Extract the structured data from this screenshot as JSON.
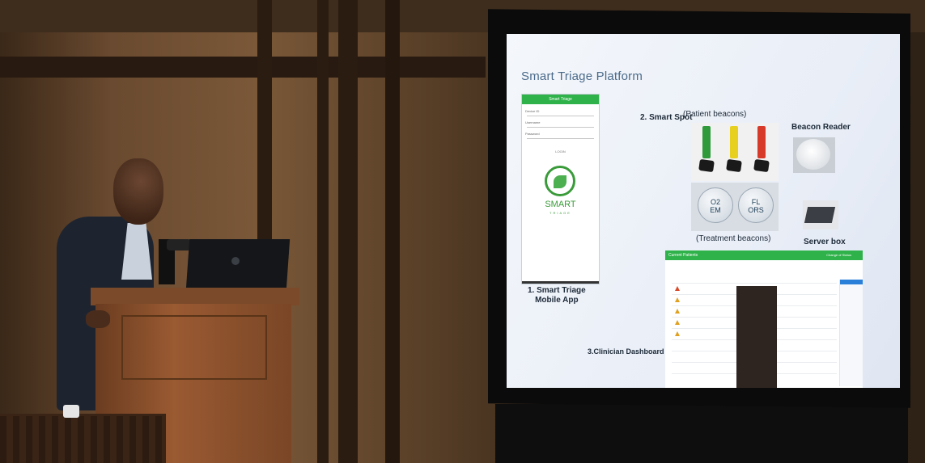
{
  "slide": {
    "title": "Smart Triage Platform",
    "phone": {
      "header": "Smart Triage",
      "field_label_1": "Device ID",
      "field_label_2": "Username",
      "field_label_3": "Password",
      "button": "LOGIN",
      "logo_text": "SMART",
      "logo_sub": "TRIAGE"
    },
    "captions": {
      "mobile_app_1": "1. Smart Triage",
      "mobile_app_2": "Mobile App",
      "smart_spot": "2. Smart Spot",
      "patient_beacons": "(Patient beacons)",
      "beacon_reader": "Beacon Reader",
      "treatment_beacons": "(Treatment beacons)",
      "server_box": "Server box",
      "clinician_dashboard": "3.Clinician Dashboard"
    },
    "treatment_coins": [
      "O2\nEM",
      "FL\nORS"
    ],
    "dashboard": {
      "bar_left": "Current Patients",
      "bar_right": "Change of Status"
    }
  },
  "colors": {
    "accent_green": "#2fb24a",
    "title_blue": "#4a6a8a",
    "beacon_green": "#2e9a3a",
    "beacon_yellow": "#e8d020",
    "beacon_red": "#d83a2a"
  }
}
